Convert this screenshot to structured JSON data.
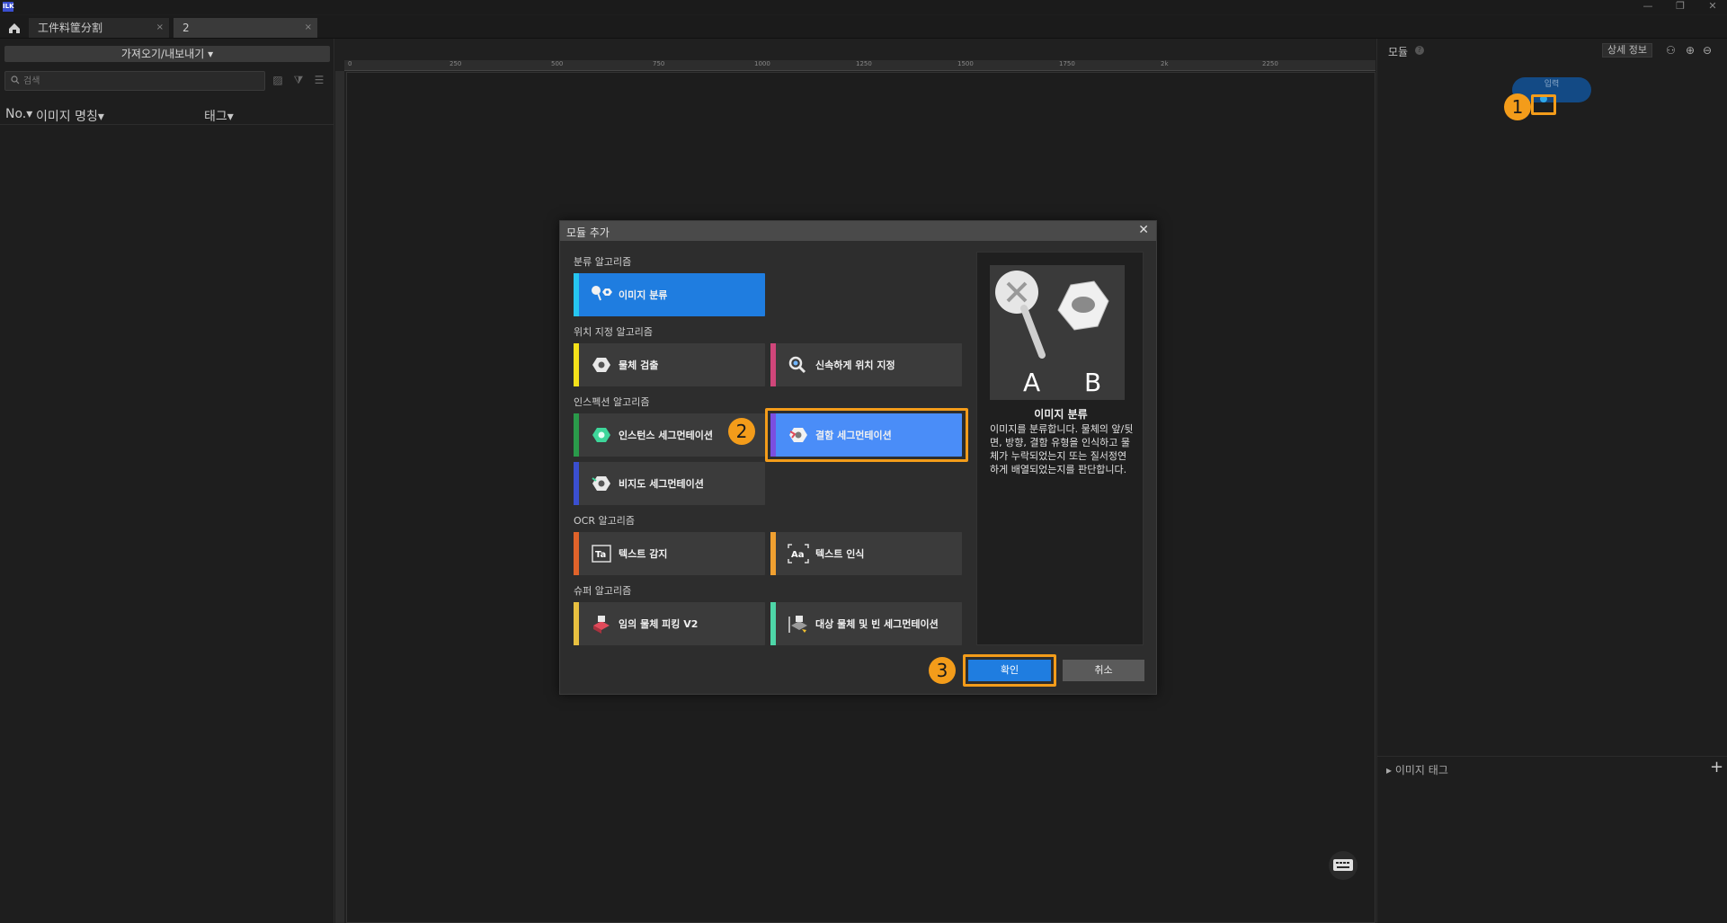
{
  "titlebar": {
    "logo": "ILK",
    "controls": [
      "—",
      "❐",
      "✕"
    ]
  },
  "tabs": [
    {
      "label": "工件料筐分割",
      "close": "×"
    },
    {
      "label": "2",
      "close": "×"
    }
  ],
  "left_panel": {
    "import_export_label": "가져오기/내보내기 ▾",
    "search_placeholder": "검색",
    "columns": {
      "no": "No.▾",
      "name": "이미지 명칭▾",
      "tag": "태그▾"
    }
  },
  "canvas": {
    "ruler_ticks": [
      "0",
      "250",
      "500",
      "750",
      "1000",
      "1250",
      "1500",
      "1750",
      "2k",
      "2250"
    ]
  },
  "right_panel": {
    "title": "모듈",
    "help": "?",
    "detail_button": "상세 정보",
    "input_module_label": "입력",
    "image_tag_label": "▸ 이미지 태그",
    "add_tag": "+"
  },
  "steps": [
    "1",
    "2",
    "3"
  ],
  "modal": {
    "title": "모듈 추가",
    "close": "✕",
    "sections": {
      "classification": "분류 알고리즘",
      "localization": "위치 지정 알고리즘",
      "instance": "인스펙션 알고리즘",
      "ocr": "OCR 알고리즘",
      "super": "슈퍼 알고리즘"
    },
    "cards": {
      "image_classification": "이미지 분류",
      "object_detection": "물체 검출",
      "fast_localization": "신속하게 위치 지정",
      "instance_segmentation": "인스턴스 세그먼테이션",
      "defect_segmentation": "결함 세그먼테이션",
      "unsupervised_segmentation": "비지도 세그먼테이션",
      "text_detection": "텍스트 감지",
      "text_recognition": "텍스트 인식",
      "any_object_picking": "임의 물체 피킹 V2",
      "object_bin_segmentation": "대상 물체 및 빈 세그먼테이션"
    },
    "preview": {
      "title": "이미지 분류",
      "label_a": "A",
      "label_b": "B",
      "description": "이미지를 분류합니다. 물체의 앞/뒷면, 방향, 결함 유형을 인식하고 물체가 누락되었는지 또는 질서정연하게 배열되었는지를 판단합니다."
    },
    "ok_label": "확인",
    "cancel_label": "취소"
  },
  "colors": {
    "accent_blue": "#1f7de0",
    "highlight_orange": "#f39c1a",
    "stripe_cyan": "#26c6f0",
    "stripe_yellow": "#f5e11a",
    "stripe_pink": "#d0467a",
    "stripe_green": "#2a9a4a",
    "stripe_violet": "#7b4fe0",
    "stripe_blue": "#3a4fd0",
    "stripe_orange": "#e0632a",
    "stripe_amber": "#f0a030",
    "stripe_gold": "#e8c040",
    "stripe_teal": "#4ed6a8"
  }
}
